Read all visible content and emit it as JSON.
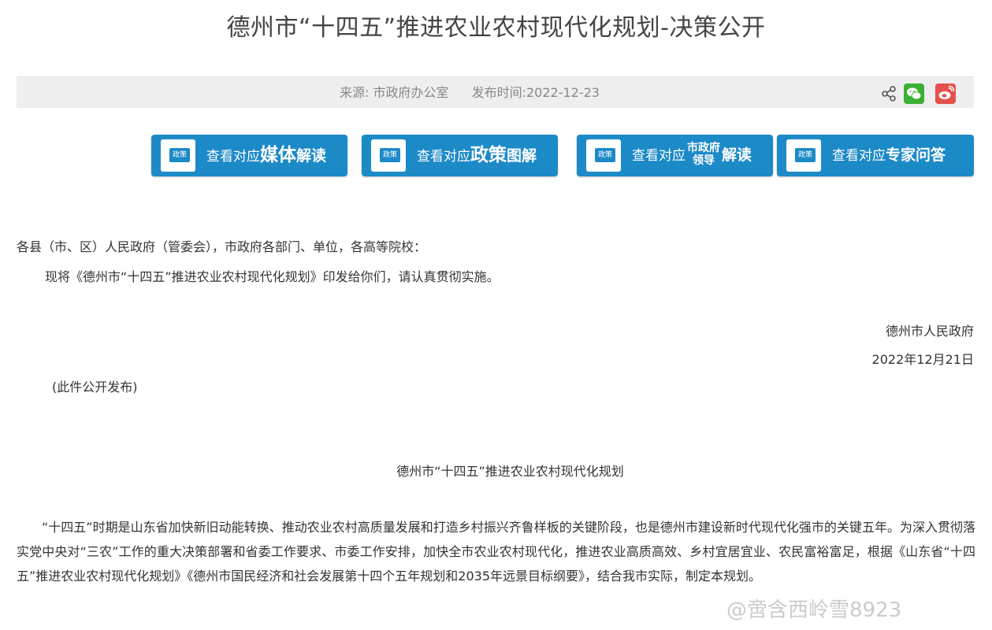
{
  "page": {
    "title": "德州市“十四五”推进农业农村现代化规划-决策公开"
  },
  "meta": {
    "source": "来源: 市政府办公室",
    "publish_time": "发布时间:2022-12-23"
  },
  "buttons": [
    {
      "prefix": "查看对应",
      "main": "媒体",
      "suffix": "解读",
      "tag": "政策"
    },
    {
      "prefix": "查看对应",
      "main": "政策",
      "suffix": "图解",
      "tag": "政策"
    },
    {
      "prefix": "查看对应",
      "stack_top": "市政府",
      "stack_bottom": "领导",
      "suffix": "解读",
      "tag": "政策"
    },
    {
      "prefix": "查看对应",
      "main": "专家问答",
      "tag": "政策"
    }
  ],
  "body": {
    "salutation": "各县（市、区）人民政府（管委会），市政府各部门、单位，各高等院校：",
    "notice": "现将《德州市“十四五”推进农业农村现代化规划》印发给你们，请认真贯彻实施。",
    "issuer": "德州市人民政府",
    "date": "2022年12月21日",
    "public_note": "(此件公开发布)",
    "doc_title": "德州市“十四五”推进农业农村现代化规划",
    "paragraph": "“十四五”时期是山东省加快新旧动能转换、推动农业农村高质量发展和打造乡村振兴齐鲁样板的关键阶段，也是德州市建设新时代现代化强市的关键五年。为深入贯彻落实党中央对“三农”工作的重大决策部署和省委工作要求、市委工作安排，加快全市农业农村现代化，推进农业高质高效、乡村宜居宜业、农民富裕富足，根据《山东省“十四五”推进农业农村现代化规划》《德州市国民经济和社会发展第十四个五年规划和2035年远景目标纲要》，结合我市实际，制定本规划。"
  },
  "watermark": "@啻含西岭雪8923",
  "colors": {
    "button_blue": "#1d8ac8",
    "wechat_green": "#3cb034",
    "weibo_red": "#e6504b"
  }
}
